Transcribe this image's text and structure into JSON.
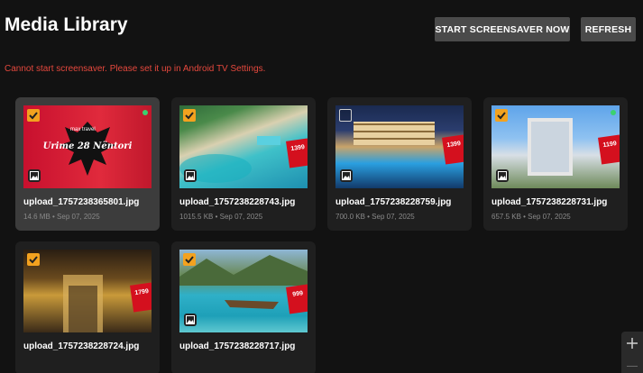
{
  "header": {
    "title": "Media Library",
    "screensaver_button": "START SCREENSAVER NOW",
    "refresh_button": "REFRESH"
  },
  "error_message": "Cannot start screensaver. Please set it up in Android TV Settings.",
  "media_items": [
    {
      "name": "upload_1757238365801.jpg",
      "meta": "14.6 MB • Sep 07, 2025",
      "checked": true,
      "selected": true,
      "art_text": "Urime 28 Nëntori",
      "art_small": "max travel"
    },
    {
      "name": "upload_1757238228743.jpg",
      "meta": "1015.5 KB • Sep 07, 2025",
      "checked": true,
      "selected": false,
      "price": "1399"
    },
    {
      "name": "upload_1757238228759.jpg",
      "meta": "700.0 KB • Sep 07, 2025",
      "checked": false,
      "selected": false,
      "price": "1399"
    },
    {
      "name": "upload_1757238228731.jpg",
      "meta": "657.5 KB • Sep 07, 2025",
      "checked": true,
      "selected": false,
      "price": "1199"
    },
    {
      "name": "upload_1757238228724.jpg",
      "meta": "",
      "checked": true,
      "selected": false,
      "price": "1799"
    },
    {
      "name": "upload_1757238228717.jpg",
      "meta": "",
      "checked": true,
      "selected": false,
      "price": "999"
    }
  ],
  "colors": {
    "accent": "#f3a21f",
    "error": "#e5483d",
    "status_dot": "#3bd16f"
  },
  "icons": {
    "checkbox": "check-icon",
    "image": "image-icon",
    "fab": "plus-icon"
  }
}
